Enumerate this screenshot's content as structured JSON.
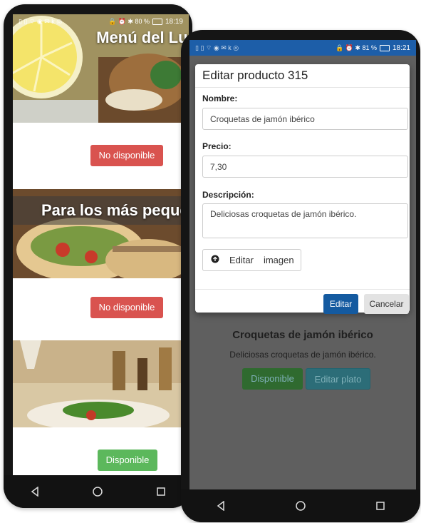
{
  "phone_left": {
    "status": {
      "left_icons": "▯ ▯ ⌔ ◉ ✉ k ◎",
      "right_text": "🔒 ⏰ ✱ 80 %",
      "time": "18:19"
    },
    "banners": [
      {
        "title": "Menú del Lun",
        "button": "No disponible"
      },
      {
        "title": "Para los más pequei",
        "button": "No disponible"
      },
      {
        "title": "",
        "button": "Disponible"
      }
    ],
    "nav": [
      "back-icon",
      "home-icon",
      "recents-icon"
    ]
  },
  "phone_right": {
    "status": {
      "left_icons": "▯ ▯ ⌔ ◉ ✉ k ◎",
      "right_text": "🔒 ⏰ ✱ 81 %",
      "time": "18:21"
    },
    "modal": {
      "title": "Editar producto 315",
      "name_label": "Nombre:",
      "name_value": "Croquetas de jamón ibérico",
      "price_label": "Precio:",
      "price_value": "7,30",
      "desc_label": "Descripción:",
      "desc_value": "Deliciosas croquetas de jamón ibérico.",
      "upload_label_1": "Editar",
      "upload_label_2": "imagen",
      "edit_button": "Editar",
      "cancel_button": "Cancelar"
    },
    "behind": {
      "title": "Croquetas de jamón ibérico",
      "description": "Deliciosas croquetas de jamón ibérico.",
      "available_button": "Disponible",
      "edit_dish_button": "Editar plato"
    },
    "nav": [
      "back-icon",
      "home-icon",
      "recents-icon"
    ]
  },
  "colors": {
    "red_button": "#d9534f",
    "green_button": "#5cb85c",
    "primary": "#145aa0",
    "status_blue": "#1d5ea8"
  }
}
